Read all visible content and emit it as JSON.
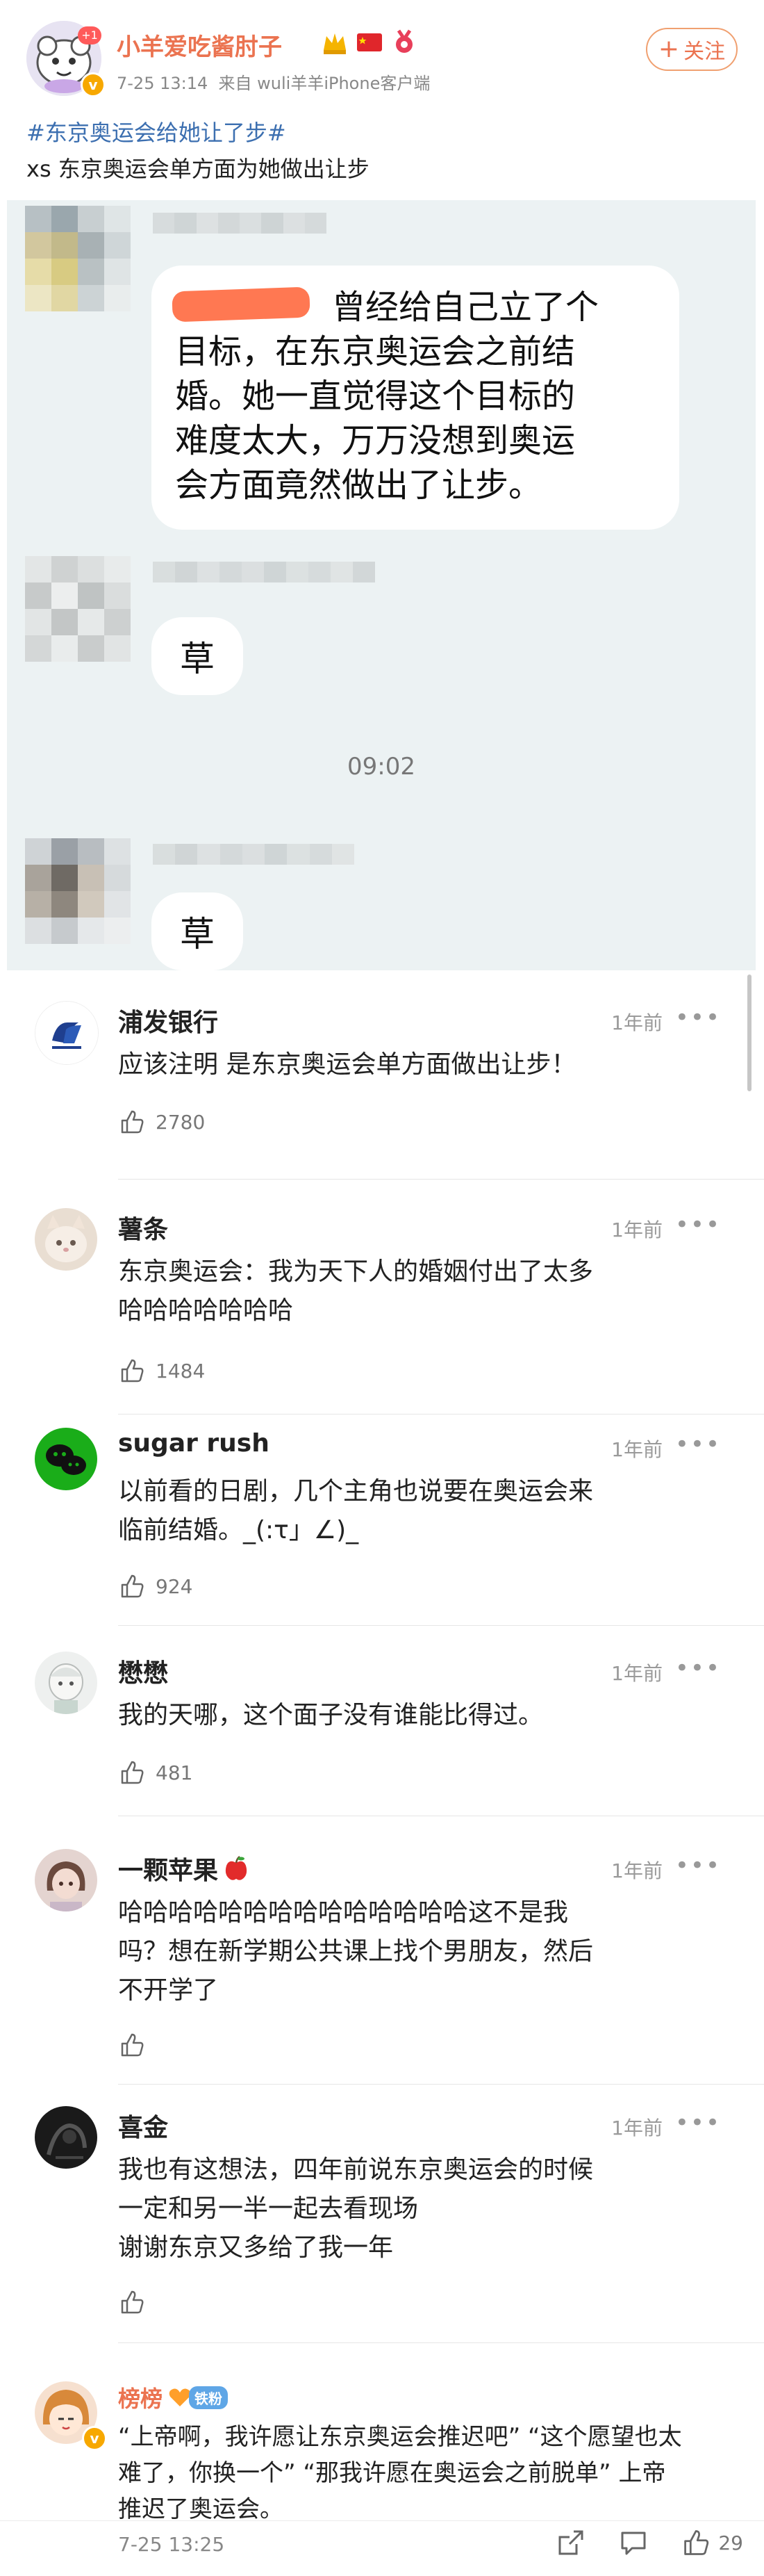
{
  "post": {
    "username": "小羊爱吃酱肘子",
    "vip_badge": "+1",
    "verified_mark": "v",
    "time": "7-25 13:14",
    "source": "来自 wuli羊羊iPhone客户端",
    "follow_label": "关注",
    "hashtag": "#东京奥运会给她让了步#",
    "text": "xs 东京奥运会单方面为她做出让步"
  },
  "chat": {
    "message_lines": [
      "曾经给自己立了个",
      "目标，在东京奥运会之前结",
      "婚。她一直觉得这个目标的",
      "难度太大，万万没想到奥运",
      "会方面竟然做出了让步。"
    ],
    "reply_1": "草",
    "time": "09:02",
    "reply_2": "草"
  },
  "comments": [
    {
      "name": "浦发银行",
      "time": "1年前",
      "more": "•••",
      "lines": [
        "应该注明  是东京奥运会单方面做出让步！"
      ],
      "likes": "2780"
    },
    {
      "name": "薯条",
      "time": "1年前",
      "more": "•••",
      "lines": [
        "东京奥运会：我为天下人的婚姻付出了太多",
        "哈哈哈哈哈哈哈"
      ],
      "likes": "1484"
    },
    {
      "name": "sugar rush",
      "time": "1年前",
      "more": "•••",
      "lines": [
        "以前看的日剧，几个主角也说要在奥运会来",
        "临前结婚。_(:τ」∠)_"
      ],
      "likes": "924"
    },
    {
      "name": "懋懋",
      "time": "1年前",
      "more": "•••",
      "lines": [
        "我的天哪，这个面子没有谁能比得过。"
      ],
      "likes": "481"
    },
    {
      "name": "一颗苹果",
      "time": "1年前",
      "more": "•••",
      "lines": [
        "哈哈哈哈哈哈哈哈哈哈哈哈哈哈这不是我",
        "吗？想在新学期公共课上找个男朋友，然后",
        "不开学了"
      ],
      "likes": ""
    },
    {
      "name": "喜金",
      "time": "1年前",
      "more": "•••",
      "lines": [
        "我也有这想法，四年前说东京奥运会的时候",
        "一定和另一半一起去看现场",
        "谢谢东京又多给了我一年"
      ],
      "likes": ""
    },
    {
      "name": "榜榜",
      "tag": "铁粉",
      "lines": [
        "“上帝啊，我许愿让东京奥运会推迟吧” “这个愿望也太",
        "难了，你换一个” “那我许愿在奥运会之前脱单” 上帝",
        "推迟了奥运会。"
      ]
    }
  ],
  "footer": {
    "time": "7-25 13:25",
    "like_count": "29"
  },
  "colors": {
    "accent": "#eb7350",
    "link": "#3c6fb0",
    "chat_bg": "#ecf2f3"
  }
}
